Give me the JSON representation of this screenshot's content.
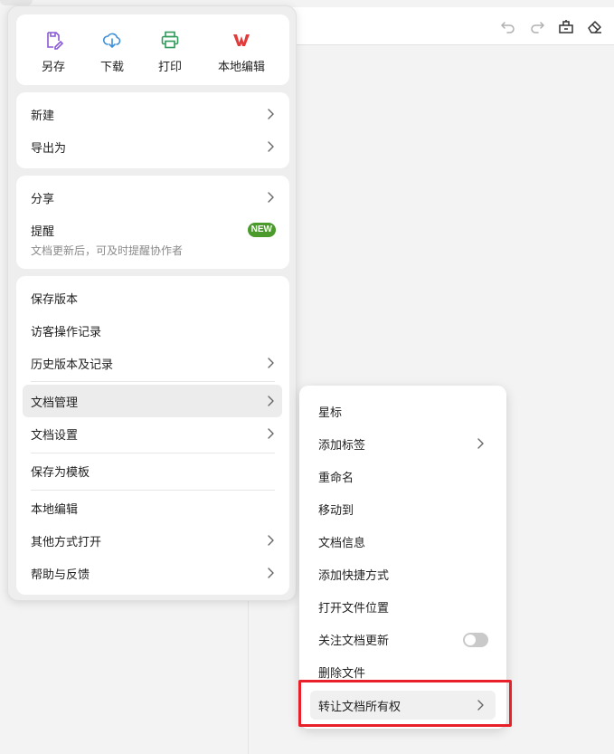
{
  "toolbar": {
    "icons": [
      "undo-icon",
      "redo-icon",
      "format-brush-icon",
      "eraser-icon"
    ]
  },
  "quick_actions": [
    {
      "label": "另存",
      "icon": "save-as-icon",
      "color": "#8a5ad6"
    },
    {
      "label": "下载",
      "icon": "download-icon",
      "color": "#3d8fd8"
    },
    {
      "label": "打印",
      "icon": "print-icon",
      "color": "#2f9a5a"
    },
    {
      "label": "本地编辑",
      "icon": "wps-logo-icon",
      "color": "#e23b3b"
    }
  ],
  "menu": {
    "new": "新建",
    "export": "导出为",
    "share": "分享",
    "remind": "提醒",
    "remind_badge": "NEW",
    "remind_sub": "文档更新后，可及时提醒协作者",
    "save_version": "保存版本",
    "visitor_log": "访客操作记录",
    "history": "历史版本及记录",
    "doc_manage": "文档管理",
    "doc_settings": "文档设置",
    "save_template": "保存为模板",
    "local_edit": "本地编辑",
    "open_with": "其他方式打开",
    "help": "帮助与反馈"
  },
  "submenu": {
    "star": "星标",
    "add_tag": "添加标签",
    "rename": "重命名",
    "move_to": "移动到",
    "doc_info": "文档信息",
    "add_shortcut": "添加快捷方式",
    "open_location": "打开文件位置",
    "follow_updates": "关注文档更新",
    "follow_updates_on": false,
    "delete": "删除文件",
    "transfer": "转让文档所有权"
  },
  "colors": {
    "badge_green": "#4a9a2c",
    "highlight_red": "#e8202a"
  }
}
